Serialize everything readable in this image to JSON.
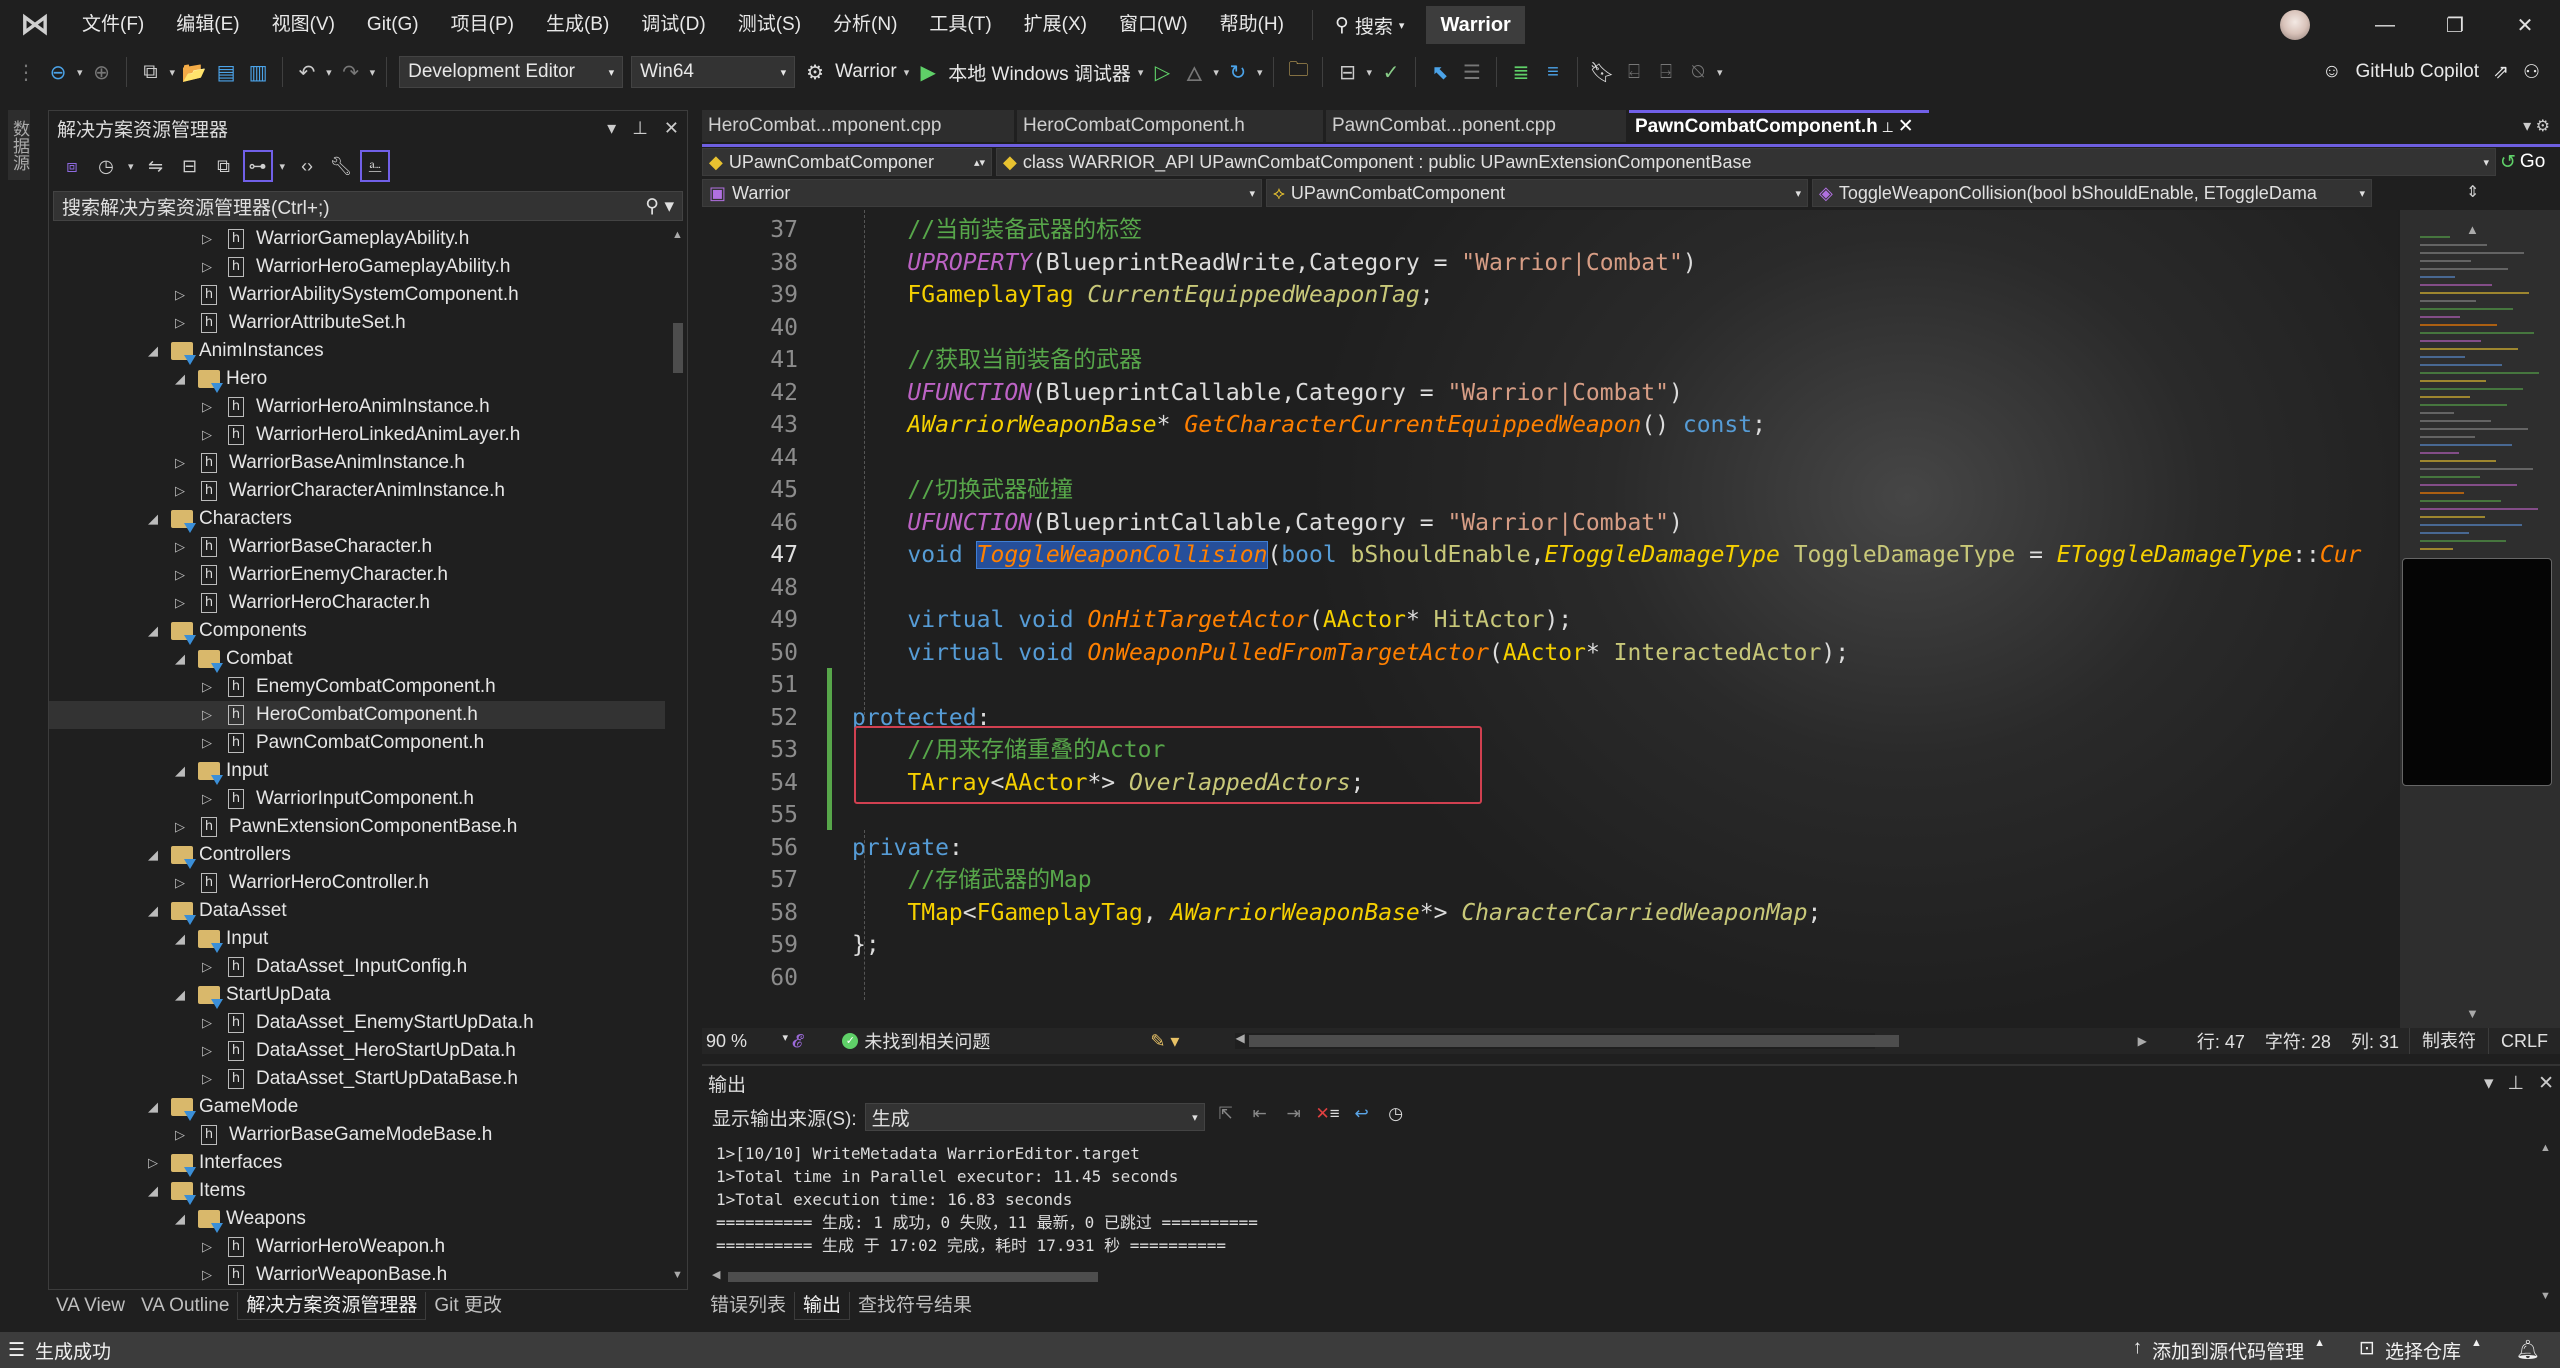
{
  "titlebar": {
    "menu": [
      "文件(F)",
      "编辑(E)",
      "视图(V)",
      "Git(G)",
      "项目(P)",
      "生成(B)",
      "调试(D)",
      "测试(S)",
      "分析(N)",
      "工具(T)",
      "扩展(X)",
      "窗口(W)",
      "帮助(H)"
    ],
    "search_label": "搜索",
    "solution_name": "Warrior",
    "window_controls": {
      "minimize": "—",
      "restore": "❐",
      "close": "✕"
    }
  },
  "toolbar": {
    "configuration": "Development Editor",
    "platform": "Win64",
    "startup_project": "Warrior",
    "debugger": "本地 Windows 调试器",
    "copilot": "GitHub Copilot"
  },
  "left_strip": {
    "datasource_tab": "数据源"
  },
  "solution_explorer": {
    "title": "解决方案资源管理器",
    "search_placeholder": "搜索解决方案资源管理器(Ctrl+;)",
    "tree": [
      {
        "label": "WarriorGameplayAbility.h",
        "type": "h",
        "depth": 3,
        "expander": "collapsed"
      },
      {
        "label": "WarriorHeroGameplayAbility.h",
        "type": "h",
        "depth": 3,
        "expander": "collapsed"
      },
      {
        "label": "WarriorAbilitySystemComponent.h",
        "type": "h",
        "depth": 2,
        "expander": "collapsed"
      },
      {
        "label": "WarriorAttributeSet.h",
        "type": "h",
        "depth": 2,
        "expander": "collapsed"
      },
      {
        "label": "AnimInstances",
        "type": "folder",
        "depth": 1,
        "expander": "expanded"
      },
      {
        "label": "Hero",
        "type": "folder",
        "depth": 2,
        "expander": "expanded"
      },
      {
        "label": "WarriorHeroAnimInstance.h",
        "type": "h",
        "depth": 3,
        "expander": "collapsed"
      },
      {
        "label": "WarriorHeroLinkedAnimLayer.h",
        "type": "h",
        "depth": 3,
        "expander": "collapsed"
      },
      {
        "label": "WarriorBaseAnimInstance.h",
        "type": "h",
        "depth": 2,
        "expander": "collapsed"
      },
      {
        "label": "WarriorCharacterAnimInstance.h",
        "type": "h",
        "depth": 2,
        "expander": "collapsed"
      },
      {
        "label": "Characters",
        "type": "folder",
        "depth": 1,
        "expander": "expanded"
      },
      {
        "label": "WarriorBaseCharacter.h",
        "type": "h",
        "depth": 2,
        "expander": "collapsed"
      },
      {
        "label": "WarriorEnemyCharacter.h",
        "type": "h",
        "depth": 2,
        "expander": "collapsed"
      },
      {
        "label": "WarriorHeroCharacter.h",
        "type": "h",
        "depth": 2,
        "expander": "collapsed"
      },
      {
        "label": "Components",
        "type": "folder",
        "depth": 1,
        "expander": "expanded"
      },
      {
        "label": "Combat",
        "type": "folder",
        "depth": 2,
        "expander": "expanded"
      },
      {
        "label": "EnemyCombatComponent.h",
        "type": "h",
        "depth": 3,
        "expander": "collapsed"
      },
      {
        "label": "HeroCombatComponent.h",
        "type": "h",
        "depth": 3,
        "expander": "collapsed",
        "selected": true
      },
      {
        "label": "PawnCombatComponent.h",
        "type": "h",
        "depth": 3,
        "expander": "collapsed"
      },
      {
        "label": "Input",
        "type": "folder",
        "depth": 2,
        "expander": "expanded"
      },
      {
        "label": "WarriorInputComponent.h",
        "type": "h",
        "depth": 3,
        "expander": "collapsed"
      },
      {
        "label": "PawnExtensionComponentBase.h",
        "type": "h",
        "depth": 2,
        "expander": "collapsed"
      },
      {
        "label": "Controllers",
        "type": "folder",
        "depth": 1,
        "expander": "expanded"
      },
      {
        "label": "WarriorHeroController.h",
        "type": "h",
        "depth": 2,
        "expander": "collapsed"
      },
      {
        "label": "DataAsset",
        "type": "folder",
        "depth": 1,
        "expander": "expanded"
      },
      {
        "label": "Input",
        "type": "folder",
        "depth": 2,
        "expander": "expanded"
      },
      {
        "label": "DataAsset_InputConfig.h",
        "type": "h",
        "depth": 3,
        "expander": "collapsed"
      },
      {
        "label": "StartUpData",
        "type": "folder",
        "depth": 2,
        "expander": "expanded"
      },
      {
        "label": "DataAsset_EnemyStartUpData.h",
        "type": "h",
        "depth": 3,
        "expander": "collapsed"
      },
      {
        "label": "DataAsset_HeroStartUpData.h",
        "type": "h",
        "depth": 3,
        "expander": "collapsed"
      },
      {
        "label": "DataAsset_StartUpDataBase.h",
        "type": "h",
        "depth": 3,
        "expander": "collapsed"
      },
      {
        "label": "GameMode",
        "type": "folder",
        "depth": 1,
        "expander": "expanded"
      },
      {
        "label": "WarriorBaseGameModeBase.h",
        "type": "h",
        "depth": 2,
        "expander": "collapsed"
      },
      {
        "label": "Interfaces",
        "type": "folder",
        "depth": 1,
        "expander": "collapsed"
      },
      {
        "label": "Items",
        "type": "folder",
        "depth": 1,
        "expander": "expanded"
      },
      {
        "label": "Weapons",
        "type": "folder",
        "depth": 2,
        "expander": "expanded"
      },
      {
        "label": "WarriorHeroWeapon.h",
        "type": "h",
        "depth": 3,
        "expander": "collapsed"
      },
      {
        "label": "WarriorWeaponBase.h",
        "type": "h",
        "depth": 3,
        "expander": "collapsed"
      }
    ],
    "bottom_tabs": [
      {
        "label": "VA View",
        "active": false
      },
      {
        "label": "VA Outline",
        "active": false
      },
      {
        "label": "解决方案资源管理器",
        "active": true
      },
      {
        "label": "Git 更改",
        "active": false
      }
    ]
  },
  "editor": {
    "tabs": [
      {
        "label": "HeroCombat...mponent.cpp",
        "active": false
      },
      {
        "label": "HeroCombatComponent.h",
        "active": false
      },
      {
        "label": "PawnCombat...ponent.cpp",
        "active": false
      },
      {
        "label": "PawnCombatComponent.h",
        "active": true
      }
    ],
    "nav_scope": "UPawnCombatComponer",
    "nav_class": "class WARRIOR_API UPawnCombatComponent : public UPawnExtensionComponentBase",
    "nav_go": "Go",
    "nav_project": "Warrior",
    "nav_type": "UPawnCombatComponent",
    "nav_member": "ToggleWeaponCollision(bool bShouldEnable, EToggleDama",
    "current_line": 47,
    "lines": [
      {
        "n": 37,
        "tokens": [
          [
            "    ",
            ""
          ],
          [
            "//当前装备武器的标签",
            "c-cm"
          ]
        ]
      },
      {
        "n": 38,
        "tokens": [
          [
            "    ",
            ""
          ],
          [
            "UPROPERTY",
            "c-macro"
          ],
          [
            "(BlueprintReadWrite,Category = ",
            ""
          ],
          [
            "\"Warrior|Combat\"",
            "c-str"
          ],
          [
            ")",
            ""
          ]
        ]
      },
      {
        "n": 39,
        "tokens": [
          [
            "    ",
            ""
          ],
          [
            "FGameplayTag",
            "c-type"
          ],
          [
            " ",
            ""
          ],
          [
            "CurrentEquippedWeaponTag",
            "c-var"
          ],
          [
            ";",
            ""
          ]
        ]
      },
      {
        "n": 40,
        "tokens": []
      },
      {
        "n": 41,
        "tokens": [
          [
            "    ",
            ""
          ],
          [
            "//获取当前装备的武器",
            "c-cm"
          ]
        ]
      },
      {
        "n": 42,
        "tokens": [
          [
            "    ",
            ""
          ],
          [
            "UFUNCTION",
            "c-macro"
          ],
          [
            "(BlueprintCallable,Category = ",
            ""
          ],
          [
            "\"Warrior|Combat\"",
            "c-str"
          ],
          [
            ")",
            ""
          ]
        ]
      },
      {
        "n": 43,
        "tokens": [
          [
            "    ",
            ""
          ],
          [
            "AWarriorWeaponBase",
            "c-typei"
          ],
          [
            "* ",
            ""
          ],
          [
            "GetCharacterCurrentEquippedWeapon",
            "c-fn"
          ],
          [
            "() ",
            ""
          ],
          [
            "const",
            "c-kw"
          ],
          [
            ";",
            ""
          ]
        ]
      },
      {
        "n": 44,
        "tokens": []
      },
      {
        "n": 45,
        "tokens": [
          [
            "    ",
            ""
          ],
          [
            "//切换武器碰撞",
            "c-cm"
          ]
        ]
      },
      {
        "n": 46,
        "tokens": [
          [
            "    ",
            ""
          ],
          [
            "UFUNCTION",
            "c-macro"
          ],
          [
            "(BlueprintCallable,Category = ",
            ""
          ],
          [
            "\"Warrior|Combat\"",
            "c-str"
          ],
          [
            ")",
            ""
          ]
        ]
      },
      {
        "n": 47,
        "tokens": [
          [
            "    ",
            ""
          ],
          [
            "void",
            "c-kw"
          ],
          [
            " ",
            ""
          ],
          [
            "ToggleWeaponCollision",
            "c-fn c-sel"
          ],
          [
            "(",
            ""
          ],
          [
            "bool",
            "c-kw"
          ],
          [
            " ",
            ""
          ],
          [
            "bShouldEnable",
            "c-param"
          ],
          [
            ",",
            ""
          ],
          [
            "EToggleDamageType",
            "c-typei"
          ],
          [
            " ",
            ""
          ],
          [
            "ToggleDamageType",
            "c-param"
          ],
          [
            " = ",
            ""
          ],
          [
            "EToggleDamageType",
            "c-typei"
          ],
          [
            "::",
            ""
          ],
          [
            "Cur",
            "c-fn"
          ]
        ]
      },
      {
        "n": 48,
        "tokens": []
      },
      {
        "n": 49,
        "tokens": [
          [
            "    ",
            ""
          ],
          [
            "virtual",
            "c-kw"
          ],
          [
            " ",
            ""
          ],
          [
            "void",
            "c-kw"
          ],
          [
            " ",
            ""
          ],
          [
            "OnHitTargetActor",
            "c-fn"
          ],
          [
            "(",
            ""
          ],
          [
            "AActor",
            "c-type"
          ],
          [
            "* ",
            ""
          ],
          [
            "HitActor",
            "c-param"
          ],
          [
            ");",
            ""
          ]
        ]
      },
      {
        "n": 50,
        "tokens": [
          [
            "    ",
            ""
          ],
          [
            "virtual",
            "c-kw"
          ],
          [
            " ",
            ""
          ],
          [
            "void",
            "c-kw"
          ],
          [
            " ",
            ""
          ],
          [
            "OnWeaponPulledFromTargetActor",
            "c-fn"
          ],
          [
            "(",
            ""
          ],
          [
            "AActor",
            "c-type"
          ],
          [
            "* ",
            ""
          ],
          [
            "InteractedActor",
            "c-param"
          ],
          [
            ");",
            ""
          ]
        ]
      },
      {
        "n": 51,
        "tokens": []
      },
      {
        "n": 52,
        "tokens": [
          [
            "protected",
            "c-kw"
          ],
          [
            ":",
            ""
          ]
        ]
      },
      {
        "n": 53,
        "tokens": [
          [
            "    ",
            ""
          ],
          [
            "//用来存储重叠的Actor",
            "c-cm"
          ]
        ]
      },
      {
        "n": 54,
        "tokens": [
          [
            "    ",
            ""
          ],
          [
            "TArray",
            "c-type"
          ],
          [
            "<",
            ""
          ],
          [
            "AActor",
            "c-type"
          ],
          [
            "*> ",
            ""
          ],
          [
            "OverlappedActors",
            "c-var"
          ],
          [
            ";",
            ""
          ]
        ]
      },
      {
        "n": 55,
        "tokens": []
      },
      {
        "n": 56,
        "tokens": [
          [
            "private",
            "c-kw"
          ],
          [
            ":",
            ""
          ]
        ]
      },
      {
        "n": 57,
        "tokens": [
          [
            "    ",
            ""
          ],
          [
            "//存储武器的Map",
            "c-cm"
          ]
        ]
      },
      {
        "n": 58,
        "tokens": [
          [
            "    ",
            ""
          ],
          [
            "TMap",
            "c-type"
          ],
          [
            "<",
            ""
          ],
          [
            "FGameplayTag",
            "c-type"
          ],
          [
            ", ",
            ""
          ],
          [
            "AWarriorWeaponBase",
            "c-typei"
          ],
          [
            "*> ",
            ""
          ],
          [
            "CharacterCarriedWeaponMap",
            "c-var"
          ],
          [
            ";",
            ""
          ]
        ]
      },
      {
        "n": 59,
        "tokens": [
          [
            "};",
            ""
          ]
        ]
      },
      {
        "n": 60,
        "tokens": []
      }
    ],
    "status": {
      "zoom": "90 %",
      "issues": "未找到相关问题",
      "line": "行: 47",
      "char": "字符: 28",
      "col": "列: 31",
      "indent": "制表符",
      "eol": "CRLF"
    }
  },
  "output": {
    "title": "输出",
    "source_label": "显示输出来源(S):",
    "source_value": "生成",
    "lines": [
      "1>[10/10] WriteMetadata WarriorEditor.target",
      "1>Total time in Parallel executor: 11.45 seconds",
      "1>Total execution time: 16.83 seconds",
      "========== 生成: 1 成功，0 失败，11 最新，0 已跳过 ==========",
      "========== 生成 于 17:02 完成，耗时 17.931 秒 =========="
    ],
    "tabs": [
      {
        "label": "错误列表",
        "active": false
      },
      {
        "label": "输出",
        "active": true
      },
      {
        "label": "查找符号结果",
        "active": false
      }
    ]
  },
  "statusbar": {
    "message": "生成成功",
    "add_source_control": "添加到源代码管理",
    "select_repo": "选择仓库"
  },
  "colors": {
    "accent": "#6e5fe0",
    "highlight_box": "#d04050",
    "change_bar": "#57a64a",
    "statusbar": "#3c3c3c"
  }
}
